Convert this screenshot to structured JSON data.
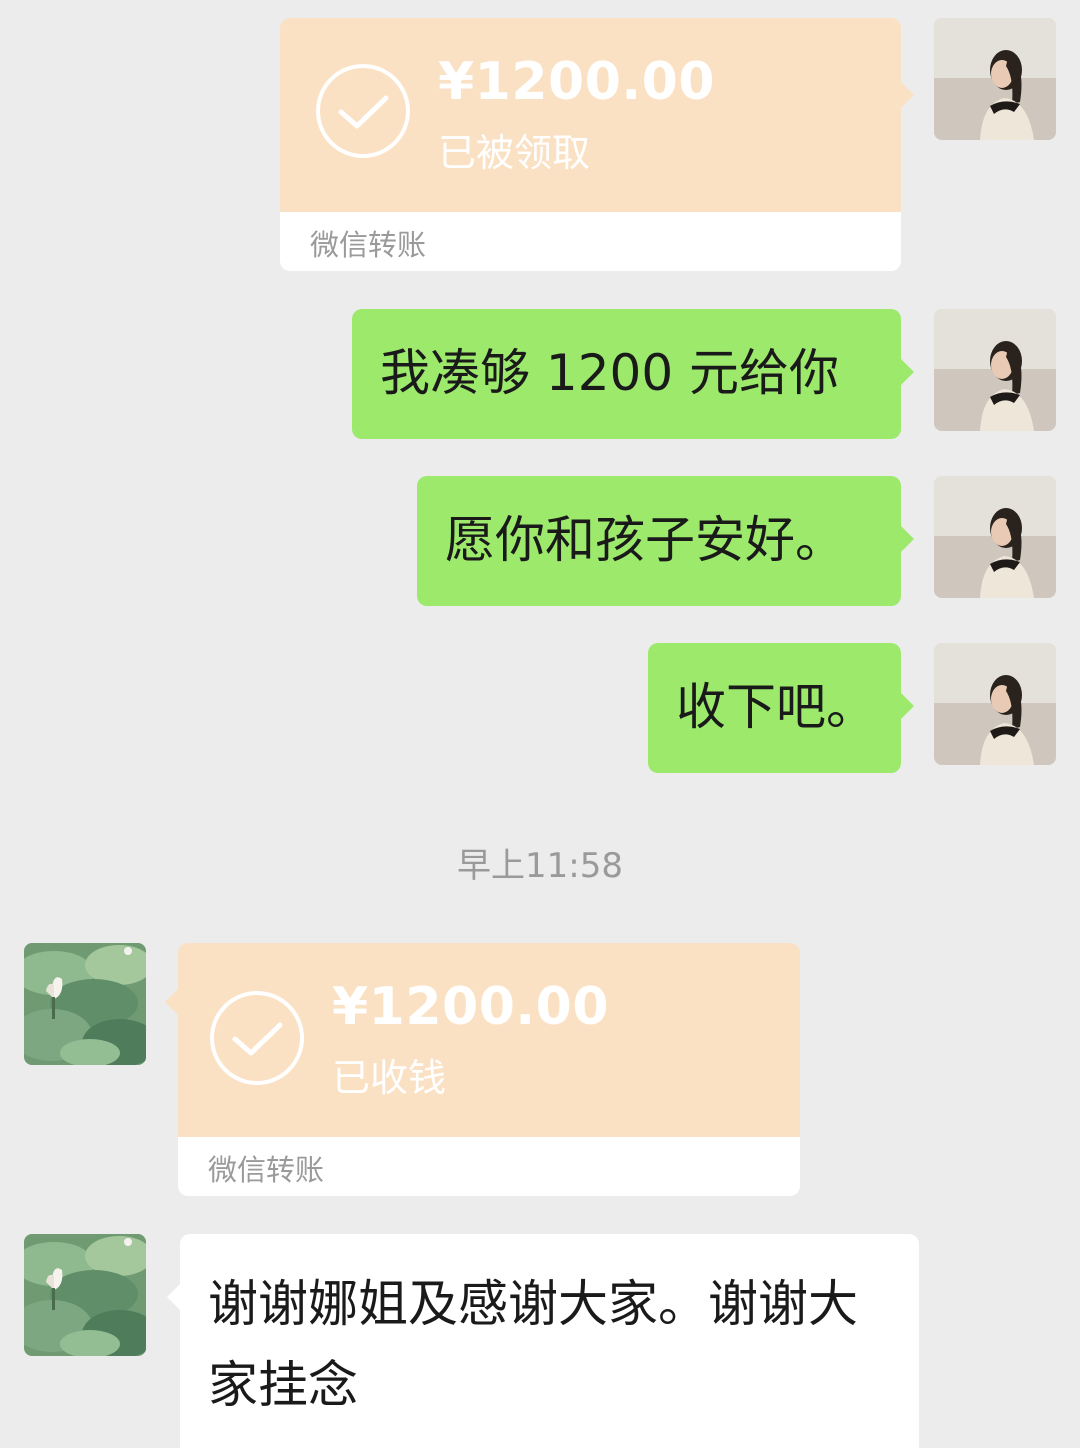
{
  "messages": [
    {
      "type": "transfer",
      "side": "outgoing",
      "amount": "¥1200.00",
      "status": "已被领取",
      "footer": "微信转账"
    },
    {
      "type": "text",
      "side": "outgoing",
      "text": "我凑够 1200 元给你"
    },
    {
      "type": "text",
      "side": "outgoing",
      "text": "愿你和孩子安好。"
    },
    {
      "type": "text",
      "side": "outgoing",
      "text": "收下吧。"
    },
    {
      "type": "timestamp",
      "text": "早上11:58"
    },
    {
      "type": "transfer",
      "side": "incoming",
      "amount": "¥1200.00",
      "status": "已收钱",
      "footer": "微信转账"
    },
    {
      "type": "text",
      "side": "incoming",
      "text": "谢谢娜姐及感谢大家。谢谢大家挂念"
    }
  ],
  "colors": {
    "background": "#ececec",
    "outgoing_bubble": "#9ce96c",
    "incoming_bubble": "#ffffff",
    "transfer_card": "#fbe1c4"
  },
  "icons": [
    "check-circle-icon",
    "woman-portrait-avatar",
    "lotus-leaf-avatar"
  ]
}
